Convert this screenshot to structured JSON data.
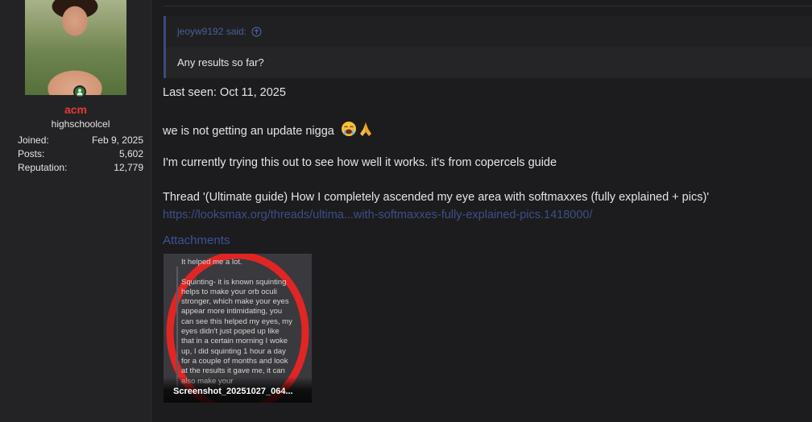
{
  "user": {
    "name": "acm",
    "title": "highschoolcel",
    "stats": [
      {
        "label": "Joined:",
        "value": "Feb 9, 2025"
      },
      {
        "label": "Posts:",
        "value": "5,602"
      },
      {
        "label": "Reputation:",
        "value": "12,779"
      }
    ],
    "online": true,
    "colors": {
      "username": "#e53935",
      "online": "#2f7d32"
    }
  },
  "quote": {
    "author": "jeoyw9192 said:",
    "icon": "arrow-up-circle-icon",
    "text": "Any results so far?"
  },
  "message": {
    "last_seen": "Last seen: Oct 11, 2025",
    "line2": "we is not getting an update nigga",
    "emojis": [
      "crying-face-icon",
      "folded-hands-icon"
    ],
    "line3": "I'm currently trying this out to see how well it works. it's from copercels guide",
    "line4": "Thread '(Ultimate guide) How I completely ascended my eye area with softmaxxes (fully explained + pics)'",
    "link": "https://looksmax.org/threads/ultima...with-softmaxxes-fully-explained-pics.1418000/"
  },
  "attachments": {
    "heading": "Attachments",
    "items": [
      {
        "caption": "Screenshot_20251027_064...",
        "preview_text": "It helped me a lot.\n\nSquinting- it is known squinting helps to make your orb oculi stronger, which make your eyes appear more intimidating, you can see this helped my eyes, my eyes didn't just poped up like that in a certain morning I woke up, I did squinting 1 hour a day for a couple of months and look at the results it gave me, it can also make your"
      }
    ]
  },
  "colors": {
    "background": "#1c1c1e",
    "link": "#3d4f87",
    "quote_accent": "#3b4a7a"
  }
}
